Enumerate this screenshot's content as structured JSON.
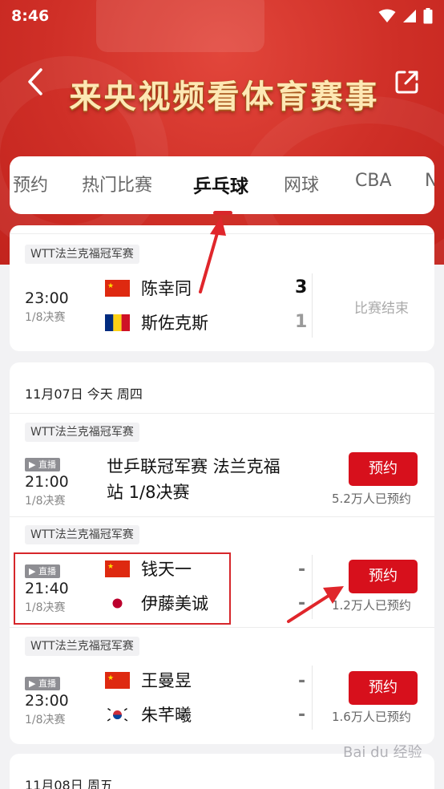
{
  "status_bar": {
    "time": "8:46"
  },
  "header": {
    "title": "来央视频看体育赛事"
  },
  "tabs": [
    {
      "label": "预约"
    },
    {
      "label": "热门比赛"
    },
    {
      "label": "乒乓球"
    },
    {
      "label": "网球"
    },
    {
      "label": "CBA"
    },
    {
      "label": "N"
    }
  ],
  "active_tab": "乒乓球",
  "finished_match": {
    "event": "WTT法兰克福冠军赛",
    "time": "23:00",
    "round": "1/8决赛",
    "team1": "陈幸同",
    "team2": "斯佐克斯",
    "score1": "3",
    "score2": "1",
    "status": "比赛结束"
  },
  "day1": {
    "date_label": "11月07日 今天 周四",
    "matches": [
      {
        "event": "WTT法兰克福冠军赛",
        "live": "直播",
        "time": "21:00",
        "round": "1/8决赛",
        "title_line1": "世乒联冠军赛 法兰克福",
        "title_line2": "站 1/8决赛",
        "button": "预约",
        "count": "5.2万人已预约"
      },
      {
        "event": "WTT法兰克福冠军赛",
        "live": "直播",
        "time": "21:40",
        "round": "1/8决赛",
        "team1": "钱天一",
        "team2": "伊藤美诚",
        "score1": "-",
        "score2": "-",
        "button": "预约",
        "count": "1.2万人已预约"
      },
      {
        "event": "WTT法兰克福冠军赛",
        "live": "直播",
        "time": "23:00",
        "round": "1/8决赛",
        "team1": "王曼昱",
        "team2": "朱芊曦",
        "score1": "-",
        "score2": "-",
        "button": "预约",
        "count": "1.6万人已预约"
      }
    ]
  },
  "day2": {
    "date_label": "11月08日 周五"
  },
  "watermark": "Bai du 经验",
  "colors": {
    "brand_red": "#d7101c",
    "header_red": "#cf2f27"
  }
}
